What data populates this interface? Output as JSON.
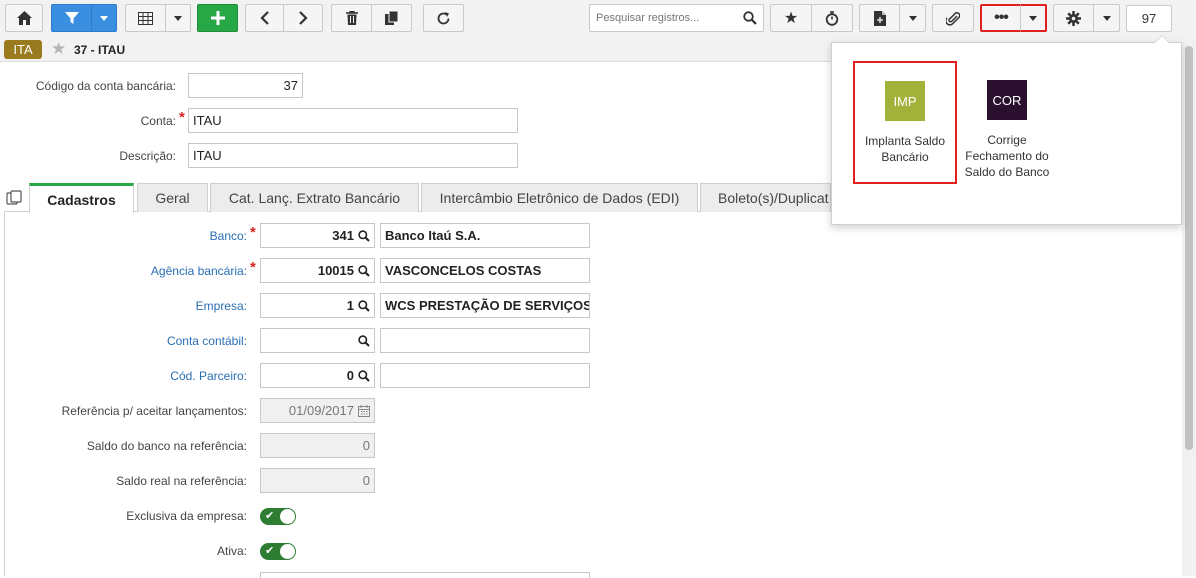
{
  "toolbar": {
    "search_placeholder": "Pesquisar registros...",
    "record_count": "97"
  },
  "record": {
    "badge": "ITA",
    "title": "37 - ITAU"
  },
  "header_fields": {
    "codigo_label": "Código da conta bancária:",
    "codigo_value": "37",
    "conta_label": "Conta:",
    "conta_value": "ITAU",
    "descricao_label": "Descrição:",
    "descricao_value": "ITAU"
  },
  "tabs": [
    {
      "label": "Cadastros"
    },
    {
      "label": "Geral"
    },
    {
      "label": "Cat. Lanç. Extrato Bancário"
    },
    {
      "label": "Intercâmbio Eletrônico de Dados (EDI)"
    },
    {
      "label": "Boleto(s)/Duplicat"
    }
  ],
  "form": {
    "banco_label": "Banco:",
    "banco_code": "341",
    "banco_name": "Banco Itaú S.A.",
    "agencia_label": "Agência bancária:",
    "agencia_code": "10015",
    "agencia_name": "VASCONCELOS COSTAS",
    "empresa_label": "Empresa:",
    "empresa_code": "1",
    "empresa_name": "WCS PRESTAÇÃO DE SERVIÇOS",
    "conta_contabil_label": "Conta contábil:",
    "conta_contabil_code": "",
    "conta_contabil_name": "",
    "parceiro_label": "Cód. Parceiro:",
    "parceiro_code": "0",
    "parceiro_name": "",
    "referencia_label": "Referência p/ aceitar lançamentos:",
    "referencia_value": "01/09/2017",
    "saldo_banco_label": "Saldo do banco na referência:",
    "saldo_banco_value": "0",
    "saldo_real_label": "Saldo real na referência:",
    "saldo_real_value": "0",
    "exclusiva_label": "Exclusiva da empresa:",
    "exclusiva_on": true,
    "ativa_label": "Ativa:",
    "ativa_on": true
  },
  "menu": {
    "items": [
      {
        "tile": "IMP",
        "label": "Implanta Saldo Bancário",
        "color": "#a1b13a"
      },
      {
        "tile": "COR",
        "label": "Corrige Fechamento do Saldo do Banco",
        "color": "#2b0f2e"
      }
    ]
  },
  "colors": {
    "accent_blue": "#3b8fe0",
    "accent_green": "#27a745",
    "highlight_red": "#e02020",
    "badge": "#9a7a1e",
    "link": "#2a6fb5"
  }
}
